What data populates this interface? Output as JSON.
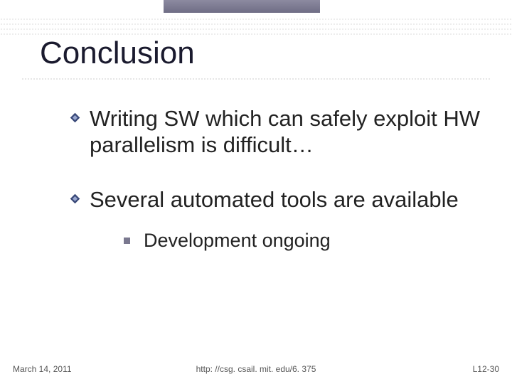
{
  "title": "Conclusion",
  "bullets": [
    "Writing SW which can safely exploit HW parallelism is difficult…",
    "Several automated tools are available"
  ],
  "subbullet": "Development ongoing",
  "footer": {
    "date": "March 14, 2011",
    "url": "http: //csg. csail. mit. edu/6. 375",
    "page": "L12-30"
  }
}
